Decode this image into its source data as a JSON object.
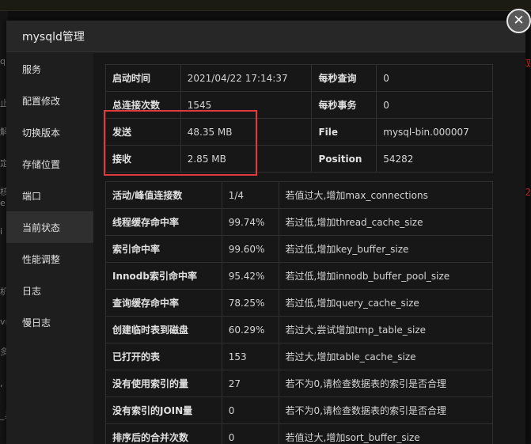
{
  "modal": {
    "title": "mysqld管理"
  },
  "sidebar": {
    "items": [
      {
        "label": "服务"
      },
      {
        "label": "配置修改"
      },
      {
        "label": "切换版本"
      },
      {
        "label": "存储位置"
      },
      {
        "label": "端口"
      },
      {
        "label": "当前状态",
        "active": true
      },
      {
        "label": "性能调整"
      },
      {
        "label": "日志"
      },
      {
        "label": "慢日志"
      }
    ]
  },
  "status": {
    "rows": [
      {
        "k1": "启动时间",
        "v1": "2021/04/22 17:14:37",
        "k2": "每秒查询",
        "v2": "0"
      },
      {
        "k1": "总连接次数",
        "v1": "1545",
        "k2": "每秒事务",
        "v2": "0"
      },
      {
        "k1": "发送",
        "v1": "48.35 MB",
        "k2": "File",
        "v2": "mysql-bin.000007"
      },
      {
        "k1": "接收",
        "v1": "2.85 MB",
        "k2": "Position",
        "v2": "54282"
      }
    ]
  },
  "perf": {
    "rows": [
      {
        "k": "活动/峰值连接数",
        "v": "1/4",
        "tip": "若值过大,增加max_connections"
      },
      {
        "k": "线程缓存命中率",
        "v": "99.74%",
        "tip": "若过低,增加thread_cache_size"
      },
      {
        "k": "索引命中率",
        "v": "99.60%",
        "tip": "若过低,增加key_buffer_size"
      },
      {
        "k": "Innodb索引命中率",
        "v": "95.42%",
        "tip": "若过低,增加innodb_buffer_pool_size"
      },
      {
        "k": "查询缓存命中率",
        "v": "78.25%",
        "tip": "若过低,增加query_cache_size"
      },
      {
        "k": "创建临时表到磁盘",
        "v": "60.29%",
        "tip": "若过大,尝试增加tmp_table_size"
      },
      {
        "k": "已打开的表",
        "v": "153",
        "tip": "若过大,增加table_cache_size"
      },
      {
        "k": "没有使用索引的量",
        "v": "27",
        "tip": "若不为0,请检查数据表的索引是否合理"
      },
      {
        "k": "没有索引的JOIN量",
        "v": "0",
        "tip": "若不为0,请检查数据表的索引是否合理"
      },
      {
        "k": "排序后的合并次数",
        "v": "0",
        "tip": "若值过大,增加sort_buffer_size"
      }
    ]
  },
  "background": {
    "left_fragments": [
      "ql",
      "止",
      "解",
      "定",
      "核",
      "e",
      "i",
      "机",
      "vn",
      "多",
      ",",
      "_具"
    ],
    "right_fragments": [
      "取",
      "5.2"
    ]
  },
  "colors": {
    "accent_red": "#e0393e",
    "active_item": "#2f2f2f"
  },
  "icons": {
    "close": "close-icon"
  }
}
